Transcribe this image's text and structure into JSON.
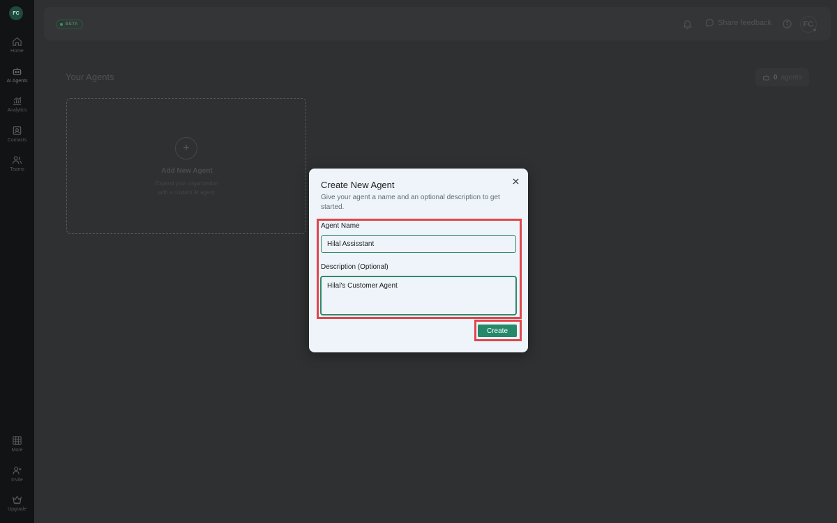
{
  "sidebar": {
    "avatar": "FC",
    "items": [
      {
        "label": "Home",
        "icon": "home-icon"
      },
      {
        "label": "AI Agents",
        "icon": "robot-icon"
      },
      {
        "label": "Analytics",
        "icon": "chart-icon"
      },
      {
        "label": "Contacts",
        "icon": "contacts-icon"
      },
      {
        "label": "Teams",
        "icon": "users-icon"
      }
    ],
    "bottom_items": [
      {
        "label": "More",
        "icon": "grid-icon"
      },
      {
        "label": "Invite",
        "icon": "user-plus-icon"
      },
      {
        "label": "Upgrade",
        "icon": "crown-icon"
      }
    ]
  },
  "header": {
    "badge": "BETA",
    "feedback_label": "Share feedback",
    "user_initials": "FC"
  },
  "main": {
    "title": "Your Agents",
    "agent_count": "0",
    "agent_count_label": "agents",
    "add_card": {
      "title": "Add New Agent",
      "desc_line1": "Expand your organization",
      "desc_line2": "with a custom AI agent."
    }
  },
  "modal": {
    "title": "Create New Agent",
    "subtitle": "Give your agent a name and an optional description to get started.",
    "name_label": "Agent Name",
    "name_value": "Hilal Assisstant",
    "desc_label": "Description (Optional)",
    "desc_value": "Hilal's Customer Agent",
    "create_label": "Create"
  },
  "colors": {
    "accent": "#25896a",
    "highlight": "#e0464b",
    "modal_bg": "#eef4f9"
  }
}
